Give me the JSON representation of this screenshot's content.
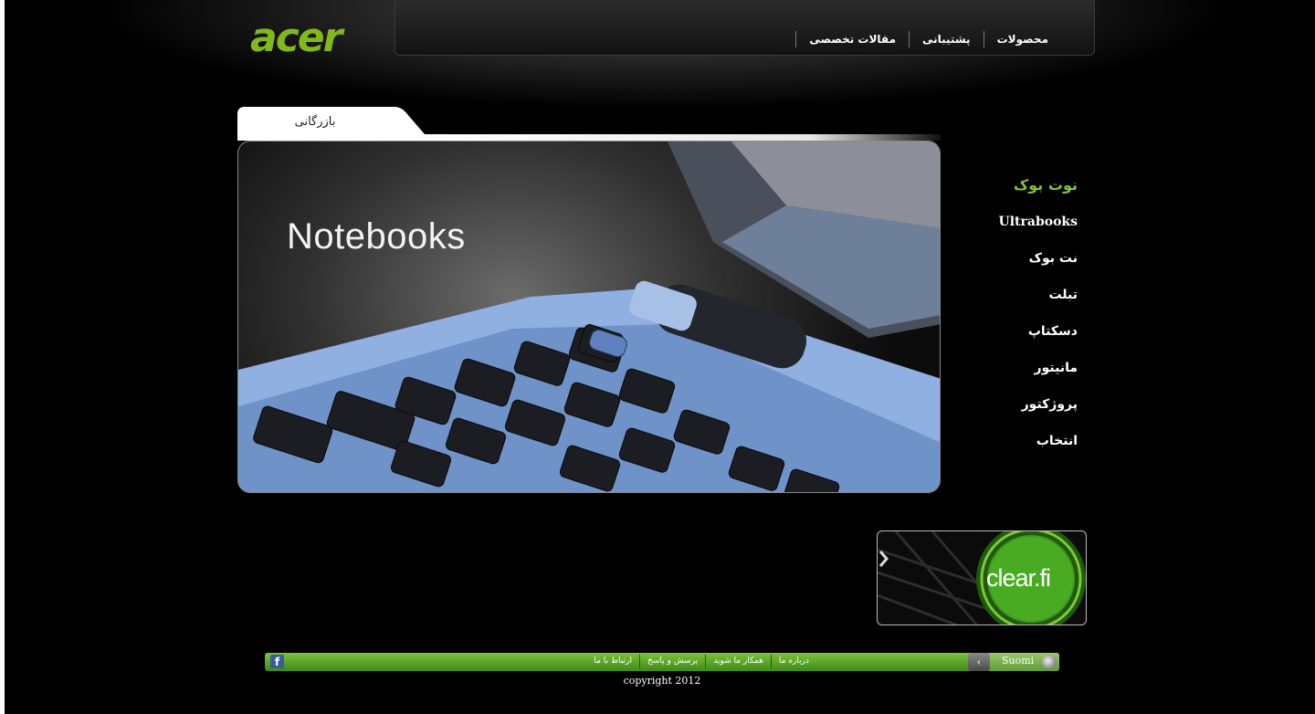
{
  "logo": {
    "text": "acer"
  },
  "nav": {
    "items": [
      "محصولات",
      "پشتیبانی",
      "مقالات تخصصی"
    ]
  },
  "tab": {
    "label": "بازرگانی"
  },
  "banner": {
    "title": "Notebooks"
  },
  "sidebar": {
    "items": [
      {
        "label": "نوت بوک",
        "active": true
      },
      {
        "label": "Ultrabooks",
        "active": false
      },
      {
        "label": "نت بوک",
        "active": false
      },
      {
        "label": "تبلت",
        "active": false
      },
      {
        "label": "دسکتاپ",
        "active": false
      },
      {
        "label": "مانیتور",
        "active": false
      },
      {
        "label": "پروژکتور",
        "active": false
      },
      {
        "label": "انتخاب",
        "active": false
      }
    ]
  },
  "promo": {
    "text": "clear.fi"
  },
  "footer": {
    "links": [
      "درباره ما",
      "همکار ما شوید",
      "پرسش و پاسخ",
      "ارتباط با ما"
    ],
    "language": "Suomi",
    "copyright": "copyright 2012",
    "social": "f"
  },
  "colors": {
    "accent": "#7fc23a",
    "background": "#000000",
    "footer_green": "#5ba22a"
  }
}
